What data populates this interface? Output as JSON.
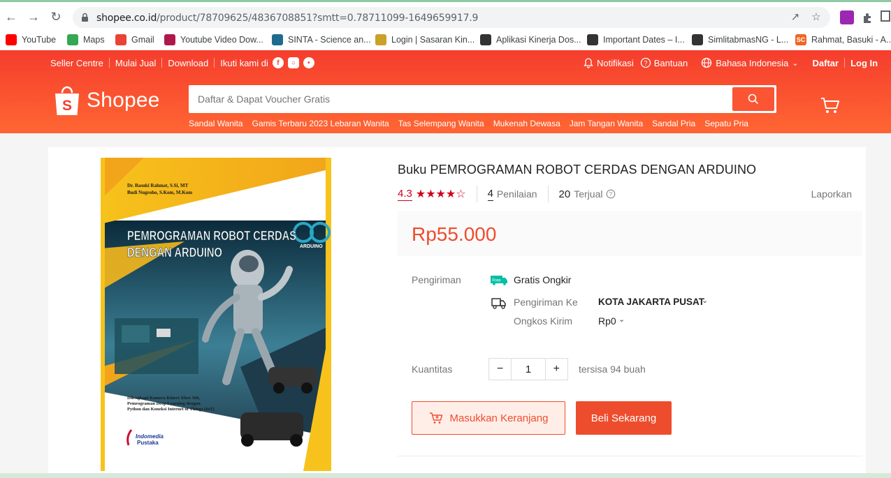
{
  "browser": {
    "url_host": "shopee.co.id",
    "url_path": "/product/78709625/4836708851?smtt=0.78711099-1649659917.9",
    "bookmarks": [
      {
        "label": "YouTube",
        "icon": "youtube-icon",
        "color": "#ff0000"
      },
      {
        "label": "Maps",
        "icon": "maps-icon",
        "color": "#34a853"
      },
      {
        "label": "Gmail",
        "icon": "gmail-icon",
        "color": "#ea4335"
      },
      {
        "label": "Youtube Video Dow...",
        "icon": "video-download-icon",
        "color": "#b0184c"
      },
      {
        "label": "SINTA - Science an...",
        "icon": "sinta-icon",
        "color": "#1f6b8f"
      },
      {
        "label": "Login | Sasaran Kin...",
        "icon": "sasaran-icon",
        "color": "#c9a227"
      },
      {
        "label": "Aplikasi Kinerja Dos...",
        "icon": "globe-icon",
        "color": "#333333"
      },
      {
        "label": "Important Dates – I...",
        "icon": "globe-icon",
        "color": "#333333"
      },
      {
        "label": "SimlitabmasNG - L...",
        "icon": "globe-icon",
        "color": "#333333"
      },
      {
        "label": "Rahmat, Basuki - A...",
        "icon": "sc-icon",
        "color": "#f26522",
        "text": "SC"
      }
    ]
  },
  "header": {
    "links": [
      "Seller Centre",
      "Mulai Jual",
      "Download"
    ],
    "follow_label": "Ikuti kami di",
    "notif": "Notifikasi",
    "help": "Bantuan",
    "language": "Bahasa Indonesia",
    "register": "Daftar",
    "login": "Log In",
    "logo_text": "Shopee",
    "search_placeholder": "Daftar & Dapat Voucher Gratis",
    "keywords": [
      "Sandal Wanita",
      "Gamis Terbaru 2023 Lebaran Wanita",
      "Tas Selempang Wanita",
      "Mukenah Dewasa",
      "Jam Tangan Wanita",
      "Sandal Pria",
      "Sepatu Pria"
    ]
  },
  "product": {
    "title": "Buku PEMROGRAMAN ROBOT CERDAS DENGAN ARDUINO",
    "rating": "4.3",
    "stars": 4.3,
    "reviews_count": "4",
    "reviews_label": "Penilaian",
    "sold_count": "20",
    "sold_label": "Terjual",
    "report": "Laporkan",
    "price": "Rp55.000",
    "shipping_label": "Pengiriman",
    "free_badge": "Free",
    "free_shipping": "Gratis Ongkir",
    "ship_to_label": "Pengiriman Ke",
    "ship_to_value": "KOTA JAKARTA PUSAT",
    "cost_label": "Ongkos Kirim",
    "cost_value": "Rp0",
    "qty_label": "Kuantitas",
    "qty_value": "1",
    "qty_minus": "−",
    "qty_plus": "+",
    "stock": "tersisa 94 buah",
    "add_to_cart": "Masukkan Keranjang",
    "buy_now": "Beli Sekarang"
  },
  "cover": {
    "authors_1": "Dr. Basuki Rahmat, S.Si, MT",
    "authors_2": "Budi Nugroho, S.Kom, M.Kom",
    "title_1": "PEMROGRAMAN ROBOT CERDAS",
    "title_2": "DENGAN ARDUINO",
    "arduino": "ARDUINO",
    "blurb_1": "Dilengkapi Kamera Kinect Xbox 360,",
    "blurb_2": "Pemrograman Deep Learning dengan",
    "blurb_3": "Python dan Koneksi Internet of Things (IoT)",
    "publisher_1": "Indomedia",
    "publisher_2": "Pustaka"
  }
}
